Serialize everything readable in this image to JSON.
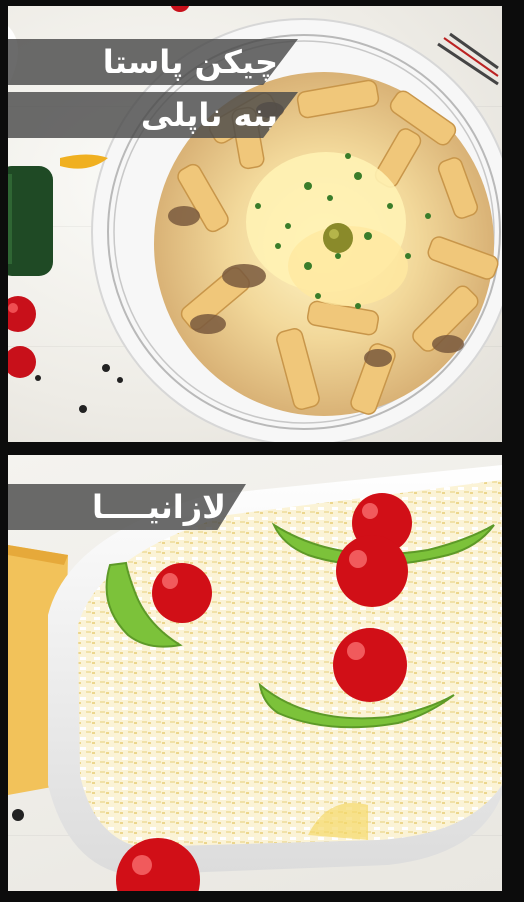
{
  "panels": [
    {
      "captions": [
        "چیکن پاستا",
        "پنه ناپلی"
      ]
    },
    {
      "captions": [
        "لازانیــــا"
      ]
    }
  ]
}
